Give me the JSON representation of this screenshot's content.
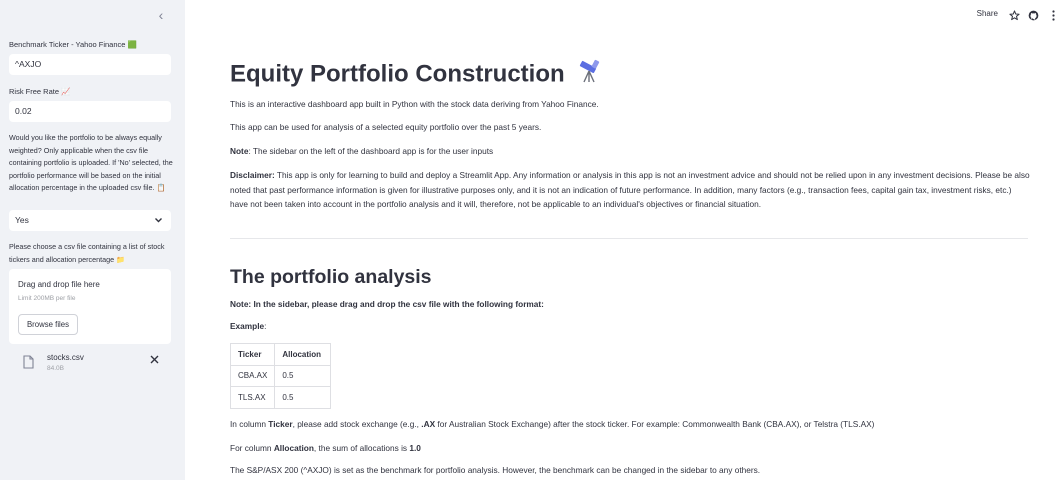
{
  "sidebar": {
    "benchmark_label": "Benchmark Ticker - Yahoo Finance 🟩",
    "benchmark_value": "^AXJO",
    "rfr_label": "Risk Free Rate 📈",
    "rfr_value": "0.02",
    "equal_weight_question": "Would you like the portfolio to be always equally weighted? Only applicable when the csv file containing portfolio is uploaded. If 'No' selected, the portfolio performance will be based on the initial allocation percentage in the uploaded csv file. 📋",
    "equal_weight_selected": "Yes",
    "csv_label": "Please choose a csv file containing a list of stock tickers and allocation percentage 📁",
    "dropzone_title": "Drag and drop file here",
    "dropzone_limit": "Limit 200MB per file",
    "browse_button": "Browse files",
    "file_name": "stocks.csv",
    "file_size": "84.0B"
  },
  "topbar": {
    "share_label": "Share"
  },
  "main": {
    "title": "Equity Portfolio Construction",
    "intro_1": "This is an interactive dashboard app built in Python with the stock data deriving from Yahoo Finance.",
    "intro_2": "This app can be used for analysis of a selected equity portfolio over the past 5 years.",
    "note_label": "Note",
    "note_text": ": The sidebar on the left of the dashboard app is for the user inputs",
    "disclaimer_label": "Disclaimer:",
    "disclaimer_text": " This app is only for learning to build and deploy a Streamlit App. Any information or analysis in this app is not an investment advice and should not be relied upon in any investment decisions. Please be also noted that past performance information is given for illustrative purposes only, and it is not an indication of future performance. In addition, many factors (e.g., transaction fees, capital gain tax, investment risks, etc.) have not been taken into account in the portfolio analysis and it will, therefore, not be applicable to an individual's objectives or financial situation.",
    "section_title": "The portfolio analysis",
    "format_note": "Note: In the sidebar, please drag and drop the csv file with the following format:",
    "example_label": "Example",
    "example_colon": ":",
    "table": {
      "headers": [
        "Ticker",
        "Allocation"
      ],
      "rows": [
        [
          "CBA.AX",
          "0.5"
        ],
        [
          "TLS.AX",
          "0.5"
        ]
      ]
    },
    "ticker_pre": "In column ",
    "ticker_bold": "Ticker",
    "ticker_mid": ", please add stock exchange (e.g., ",
    "ticker_ax": ".AX",
    "ticker_post": " for Australian Stock Exchange) after the stock ticker. For example: Commonwealth Bank (CBA.AX), or Telstra (TLS.AX)",
    "alloc_pre": "For column ",
    "alloc_bold": "Allocation",
    "alloc_mid": ", the sum of allocations is ",
    "alloc_value": "1.0",
    "benchmark_note": "The S&P/ASX 200 (^AXJO) is set as the benchmark for portfolio analysis. However, the benchmark can be changed in the sidebar to any others."
  }
}
